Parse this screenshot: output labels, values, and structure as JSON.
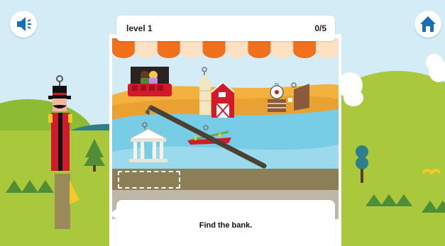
{
  "header": {
    "level_label": "level 1",
    "score_label": "0/5"
  },
  "prompt": {
    "text": "Find the bank."
  },
  "controls": {
    "sound_icon": "speaker-icon",
    "home_icon": "home-icon"
  },
  "scene_items": [
    {
      "name": "theater-stage",
      "icon": "theater-icon"
    },
    {
      "name": "farm-barn",
      "icon": "barn-icon"
    },
    {
      "name": "target-range",
      "icon": "target-icon"
    },
    {
      "name": "bank",
      "icon": "bank-icon"
    },
    {
      "name": "seesaw-boat",
      "icon": "seesaw-icon"
    }
  ],
  "colors": {
    "sky": "#d3ecf6",
    "grass": "#a8c93a",
    "awning_orange": "#f0701e",
    "awning_light": "#fde1c2",
    "ringmaster_red": "#d11a2a"
  }
}
